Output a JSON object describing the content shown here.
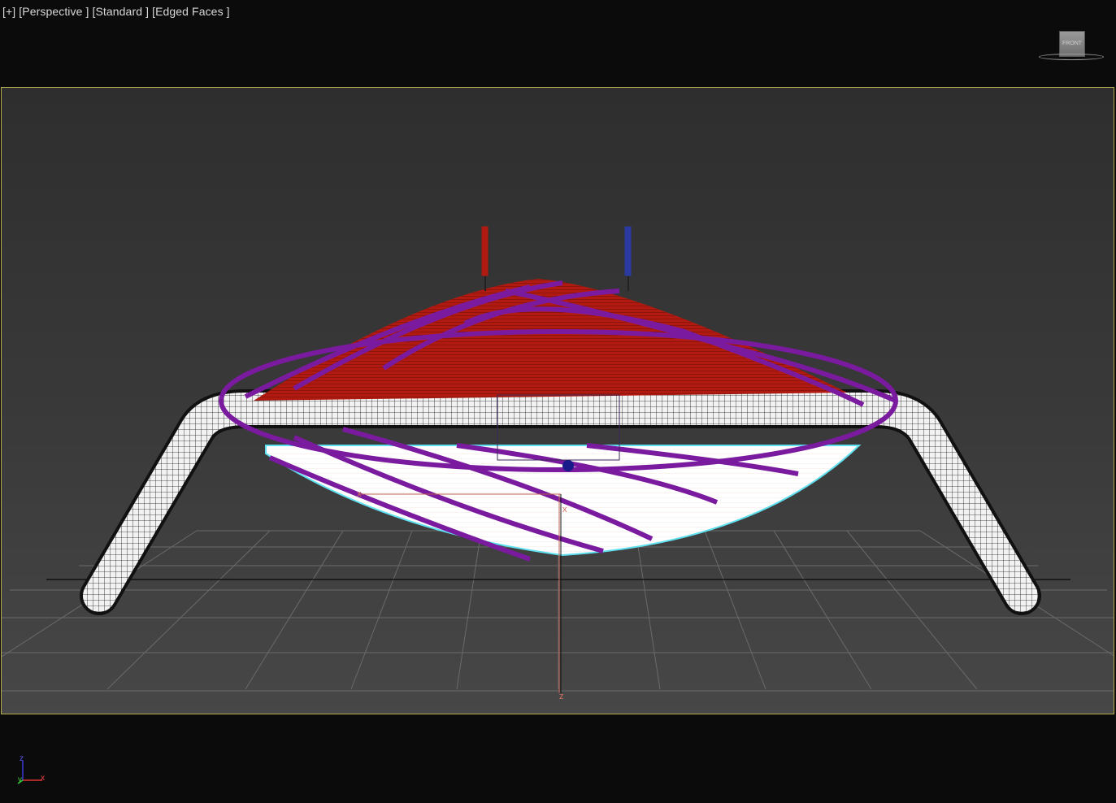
{
  "viewport_label": {
    "plus": "[+]",
    "view": "[Perspective ]",
    "shading": "[Standard ]",
    "mode": "[Edged Faces ]"
  },
  "viewcube": {
    "face_label": "FRONT"
  },
  "gizmo": {
    "x_label": "x",
    "z_label": "z"
  },
  "axis_tripod": {
    "z": "z",
    "y": "y",
    "x": "x"
  },
  "colors": {
    "viewport_border": "#b7b04a",
    "spline": "#7a1a9e",
    "red_shade": "#b01a10",
    "axis_x": "#d33",
    "axis_y": "#3c3",
    "axis_z": "#33d"
  }
}
